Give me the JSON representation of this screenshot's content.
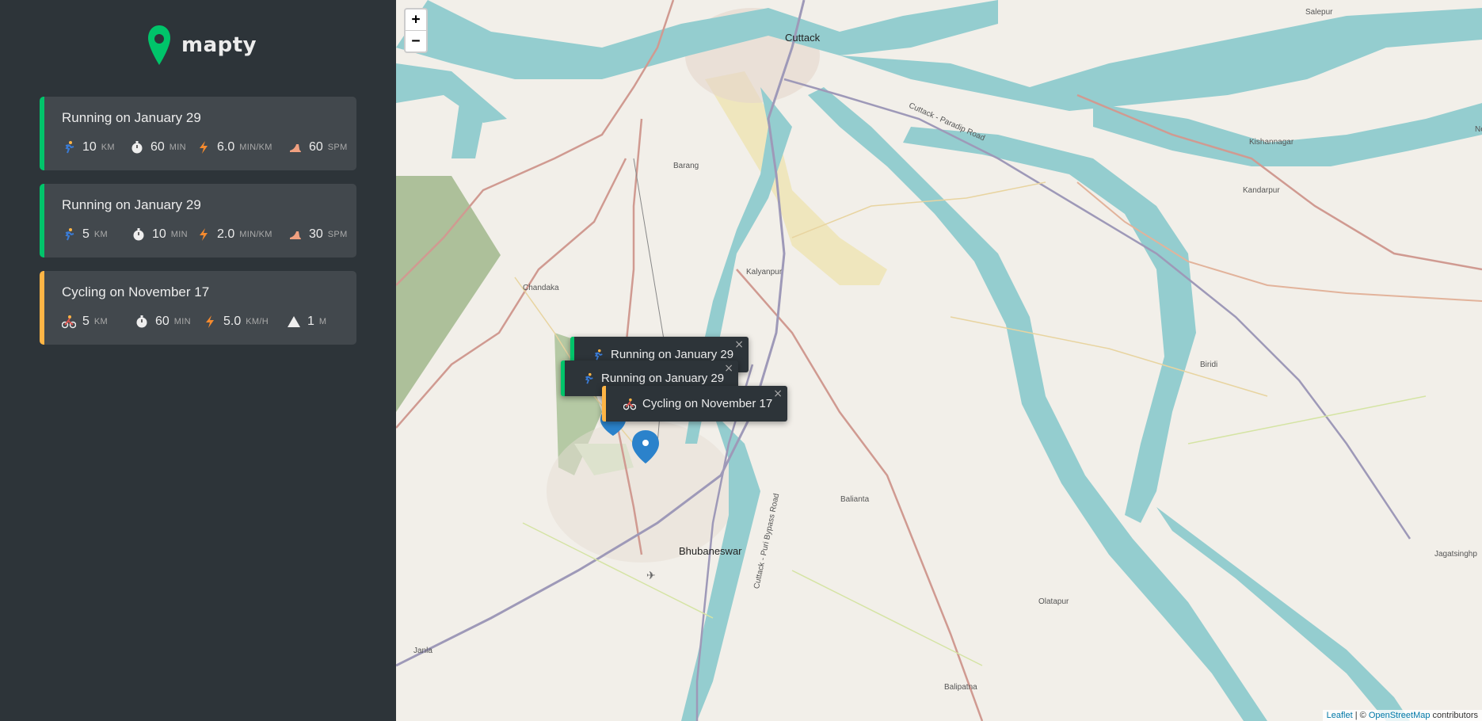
{
  "app": {
    "name": "mapty",
    "brand_color": "#00c46a",
    "running_color": "#00c46a",
    "cycling_color": "#ffb545"
  },
  "workouts": [
    {
      "type": "running",
      "title": "Running on January 29",
      "details": [
        {
          "icon": "running-icon",
          "value": "10",
          "unit": "km"
        },
        {
          "icon": "stopwatch-icon",
          "value": "60",
          "unit": "min"
        },
        {
          "icon": "lightning-icon",
          "value": "6.0",
          "unit": "min/km"
        },
        {
          "icon": "footprint-icon",
          "value": "60",
          "unit": "spm"
        }
      ]
    },
    {
      "type": "running",
      "title": "Running on January 29",
      "details": [
        {
          "icon": "running-icon",
          "value": "5",
          "unit": "km"
        },
        {
          "icon": "stopwatch-icon",
          "value": "10",
          "unit": "min"
        },
        {
          "icon": "lightning-icon",
          "value": "2.0",
          "unit": "min/km"
        },
        {
          "icon": "footprint-icon",
          "value": "30",
          "unit": "spm"
        }
      ]
    },
    {
      "type": "cycling",
      "title": "Cycling on November 17",
      "details": [
        {
          "icon": "cycling-icon",
          "value": "5",
          "unit": "km"
        },
        {
          "icon": "stopwatch-icon",
          "value": "60",
          "unit": "min"
        },
        {
          "icon": "lightning-icon",
          "value": "5.0",
          "unit": "km/h"
        },
        {
          "icon": "mountain-icon",
          "value": "1",
          "unit": "m"
        }
      ]
    }
  ],
  "map": {
    "zoom_in_label": "+",
    "zoom_out_label": "−",
    "popups": [
      {
        "type": "running",
        "icon": "running-icon",
        "text": "Running on January 29",
        "close": "×"
      },
      {
        "type": "running",
        "icon": "running-icon",
        "text": "Running on January 29",
        "close": "×"
      },
      {
        "type": "cycling",
        "icon": "cycling-icon",
        "text": "Cycling on November 17",
        "close": "×"
      }
    ],
    "places": {
      "cuttack": "Cuttack",
      "bhubaneswar": "Bhubaneswar",
      "salepur": "Salepur",
      "kishannagar": "Kishannagar",
      "kandarpur": "Kandarpur",
      "barang": "Barang",
      "kalyanpur": "Kalyanpur",
      "chandaka": "Chandaka",
      "biridi": "Biridi",
      "balianta": "Balianta",
      "olatapur": "Olatapur",
      "balipatna": "Balipatna",
      "jagatsinghpur": "Jagatsinghp",
      "janla": "Janla",
      "road_cuttack_paradip": "Cuttack - Paradip Road",
      "road_cuttack_puri": "Cuttack - Puri Bypass Road",
      "ne": "Ne"
    },
    "attribution": {
      "leaflet": "Leaflet",
      "separator": " | © ",
      "osm": "OpenStreetMap",
      "suffix": " contributors"
    }
  }
}
